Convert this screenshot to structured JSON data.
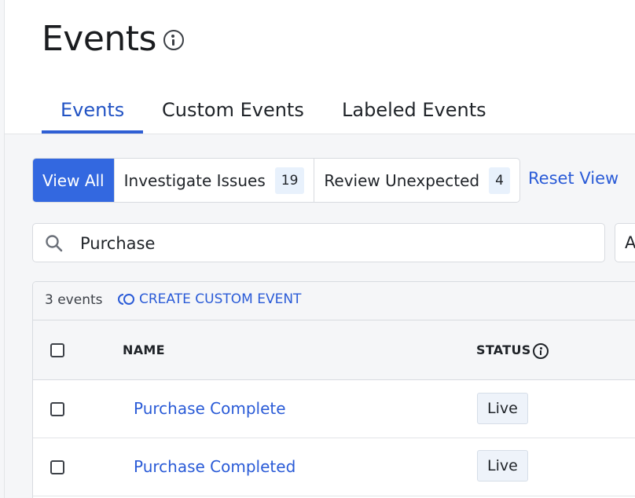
{
  "page": {
    "title": "Events"
  },
  "tabs": [
    {
      "label": "Events",
      "active": true
    },
    {
      "label": "Custom Events",
      "active": false
    },
    {
      "label": "Labeled Events",
      "active": false
    }
  ],
  "filters": {
    "view_all": "View All",
    "investigate": {
      "label": "Investigate Issues",
      "count": "19"
    },
    "review": {
      "label": "Review Unexpected",
      "count": "4"
    },
    "reset": "Reset View"
  },
  "search": {
    "value": "Purchase",
    "icon": "search-icon"
  },
  "side_select": {
    "value": "A"
  },
  "table": {
    "event_count": "3 events",
    "create_label": "CREATE CUSTOM EVENT",
    "columns": {
      "name": "NAME",
      "status": "STATUS"
    },
    "rows": [
      {
        "name": "Purchase Complete",
        "status": "Live"
      },
      {
        "name": "Purchase Completed",
        "status": "Live"
      }
    ]
  },
  "colors": {
    "accent": "#3368e0",
    "link": "#2a5bd7",
    "badge_bg": "#e8f1fc",
    "panel_bg": "#f5f6f8"
  }
}
